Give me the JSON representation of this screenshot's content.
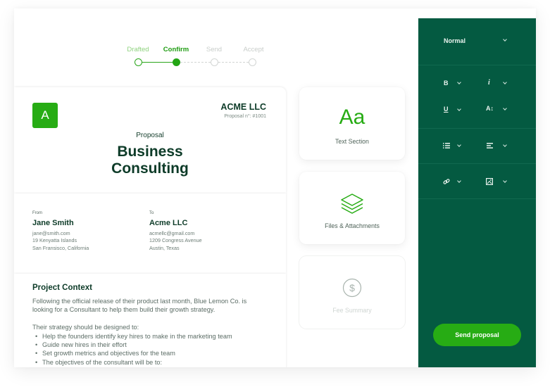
{
  "stepper": {
    "steps": [
      {
        "label": "Drafted",
        "state": "done"
      },
      {
        "label": "Confirm",
        "state": "active"
      },
      {
        "label": "Send",
        "state": "pending"
      },
      {
        "label": "Accept",
        "state": "pending"
      }
    ]
  },
  "document": {
    "logo_letter": "A",
    "company": "ACME LLC",
    "proposal_number": "Proposal n°: #1001",
    "kicker": "Proposal",
    "title_line1": "Business",
    "title_line2": "Consulting",
    "from": {
      "label": "From",
      "name": "Jane Smith",
      "email": "jane@smith.com",
      "address1": "19 Kenyatta Islands",
      "address2": "San Fransisco, California"
    },
    "to": {
      "label": "To",
      "name": "Acme LLC",
      "email": "acmellc@gmail.com",
      "address1": "1209 Congress Avenue",
      "address2": "Austin, Texas"
    },
    "context": {
      "title": "Project Context",
      "paragraph": "Following the official release of their product last month, Blue Lemon Co. is looking for a Consultant to help them build their growth strategy.",
      "list_intro": "Their strategy should be designed to:",
      "bullets": [
        "Help the founders identify key hires to make in the marketing team",
        "Guide new hires in their effort",
        "Set growth metrics and objectives for the team",
        "The objectives of the consultant will be to:"
      ]
    }
  },
  "blocks": [
    {
      "label": "Text Section",
      "icon": "text-aa-icon",
      "glyph": "Aa",
      "enabled": true
    },
    {
      "label": "Files & Attachments",
      "icon": "layers-icon",
      "enabled": true
    },
    {
      "label": "Fee Summary",
      "icon": "dollar-circle-icon",
      "enabled": false
    }
  ],
  "toolbar": {
    "text_style": "Normal",
    "bold": "B",
    "italic": "i",
    "underline": "U",
    "font_size": "A↕",
    "send_label": "Send proposal"
  },
  "colors": {
    "brand_green": "#27ac14",
    "toolbar_bg": "#045a41",
    "heading": "#0d3b28"
  }
}
